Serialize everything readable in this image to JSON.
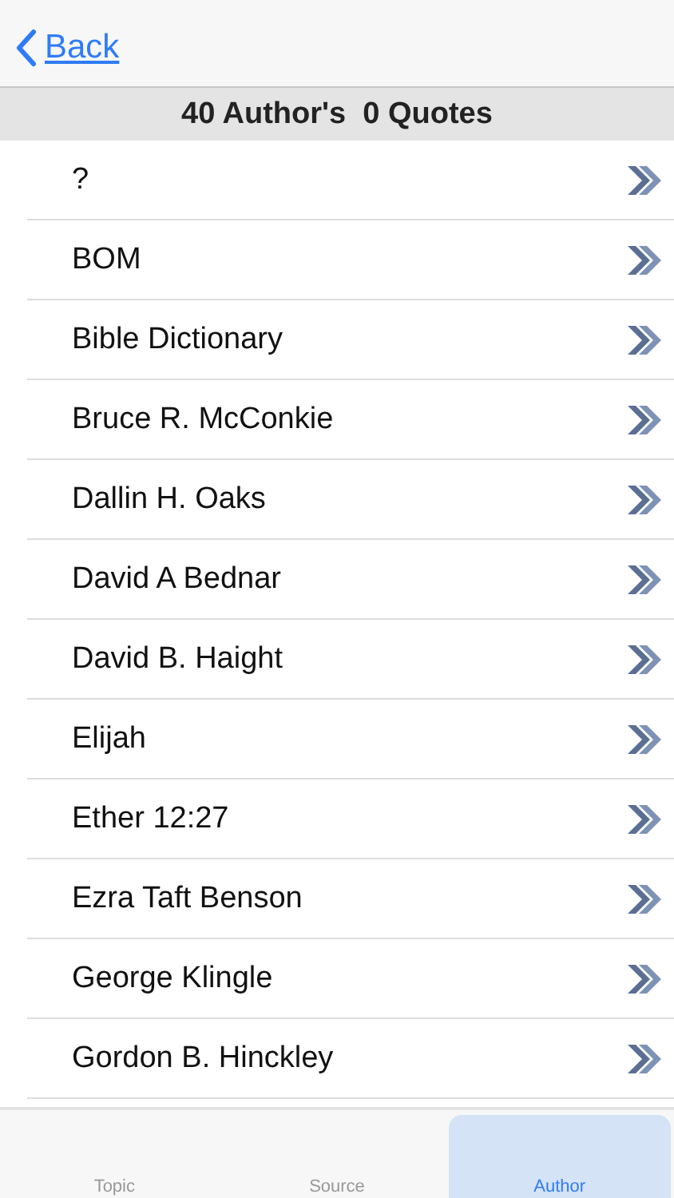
{
  "nav": {
    "back": "Back"
  },
  "header": "40 Author's  0 Quotes",
  "authors": [
    "?",
    "BOM",
    "Bible Dictionary",
    "Bruce R. McConkie",
    "Dallin H. Oaks",
    "David A Bednar",
    "David B. Haight",
    "Elijah",
    "Ether 12:27",
    "Ezra Taft Benson",
    "George Klingle",
    "Gordon B. Hinckley"
  ],
  "tabs": [
    {
      "label": "Topic",
      "selected": false
    },
    {
      "label": "Source",
      "selected": false
    },
    {
      "label": "Author",
      "selected": true
    }
  ]
}
